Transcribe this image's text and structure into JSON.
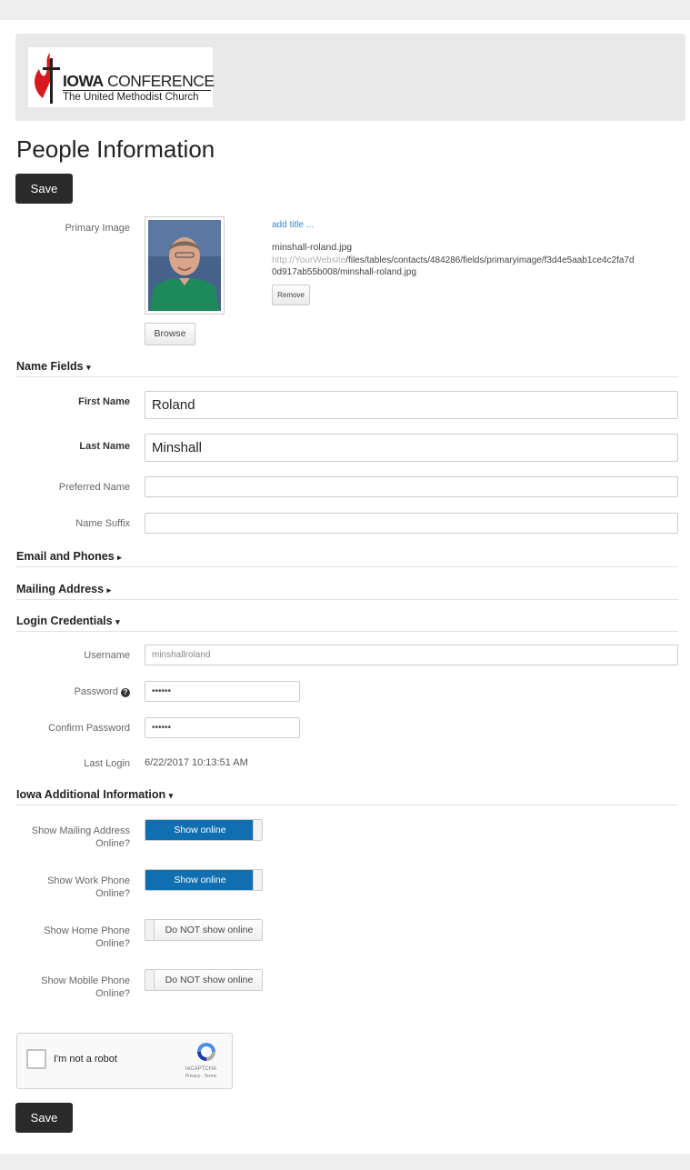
{
  "logo": {
    "title_bold": "IOWA",
    "title_rest": " CONFERENCE",
    "subtitle": "The United Methodist Church"
  },
  "page_title": "People Information",
  "save_label": "Save",
  "primary_image": {
    "label": "Primary Image",
    "add_title_link": "add title ...",
    "filename": "minshall-roland.jpg",
    "url_prefix": "http://YourWebsite",
    "url_path_line1": "/files/tables/contacts/484286/fields/primaryimage/f3d4e5aab1ce4c2fa7d",
    "url_path_line2": "0d917ab55b008/minshall-roland.jpg",
    "remove_label": "Remove",
    "browse_label": "Browse"
  },
  "sections": {
    "name_fields": "Name Fields",
    "email_phones": "Email and Phones",
    "mailing_address": "Mailing Address",
    "login_credentials": "Login Credentials",
    "iowa_additional": "Iowa Additional Information"
  },
  "name_fields": {
    "first_name_label": "First Name",
    "first_name_value": "Roland",
    "last_name_label": "Last Name",
    "last_name_value": "Minshall",
    "preferred_name_label": "Preferred Name",
    "preferred_name_value": "",
    "name_suffix_label": "Name Suffix",
    "name_suffix_value": ""
  },
  "login": {
    "username_label": "Username",
    "username_value": "minshallroland",
    "password_label": "Password",
    "password_value": "••••••",
    "confirm_label": "Confirm Password",
    "confirm_value": "••••••",
    "last_login_label": "Last Login",
    "last_login_value": "6/22/2017 10:13:51 AM"
  },
  "iowa_info": {
    "mailing_label_1": "Show Mailing Address",
    "mailing_label_2": "Online?",
    "mailing_state": "Show online",
    "work_label_1": "Show Work Phone",
    "work_label_2": "Online?",
    "work_state": "Show online",
    "home_label_1": "Show Home Phone",
    "home_label_2": "Online?",
    "home_state": "Do NOT show online",
    "mobile_label_1": "Show Mobile Phone",
    "mobile_label_2": "Online?",
    "mobile_state": "Do NOT show online"
  },
  "captcha": {
    "label": "I'm not a robot",
    "brand": "reCAPTCHA",
    "links": "Privacy - Terms"
  },
  "colors": {
    "toggle_on": "#0f6fb0",
    "button_dark": "#2a2a2a",
    "link": "#3a87c8"
  },
  "icons": {
    "help": "question-circle-icon",
    "expanded": "caret-down-icon",
    "collapsed": "caret-right-icon"
  }
}
